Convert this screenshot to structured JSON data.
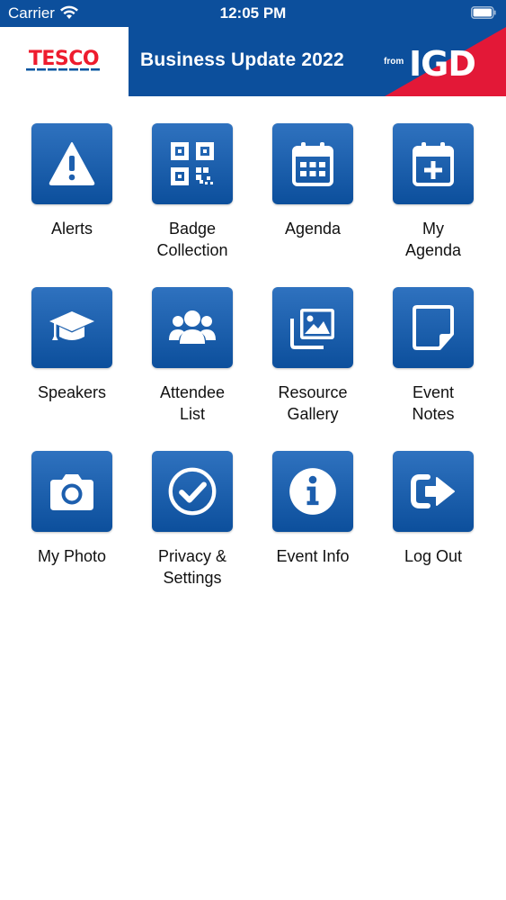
{
  "status_bar": {
    "carrier": "Carrier",
    "time": "12:05 PM"
  },
  "banner": {
    "brand": "TESCO",
    "title": "Business Update 2022",
    "from": "from",
    "partner": "IGD",
    "colors": {
      "blue": "#0c4f9c",
      "red": "#e31837",
      "tesco_red": "#ee1c2e",
      "tesco_blue": "#00539f"
    }
  },
  "tiles": [
    {
      "label": "Alerts",
      "icon": "warning-icon"
    },
    {
      "label": "Badge\nCollection",
      "icon": "qr-code-icon"
    },
    {
      "label": "Agenda",
      "icon": "calendar-icon"
    },
    {
      "label": "My\nAgenda",
      "icon": "calendar-plus-icon"
    },
    {
      "label": "Speakers",
      "icon": "graduation-cap-icon"
    },
    {
      "label": "Attendee\nList",
      "icon": "users-icon"
    },
    {
      "label": "Resource\nGallery",
      "icon": "images-icon"
    },
    {
      "label": "Event\nNotes",
      "icon": "sticky-note-icon"
    },
    {
      "label": "My Photo",
      "icon": "camera-icon"
    },
    {
      "label": "Privacy &\nSettings",
      "icon": "check-circle-icon"
    },
    {
      "label": "Event Info",
      "icon": "info-icon"
    },
    {
      "label": "Log Out",
      "icon": "sign-out-icon"
    }
  ]
}
